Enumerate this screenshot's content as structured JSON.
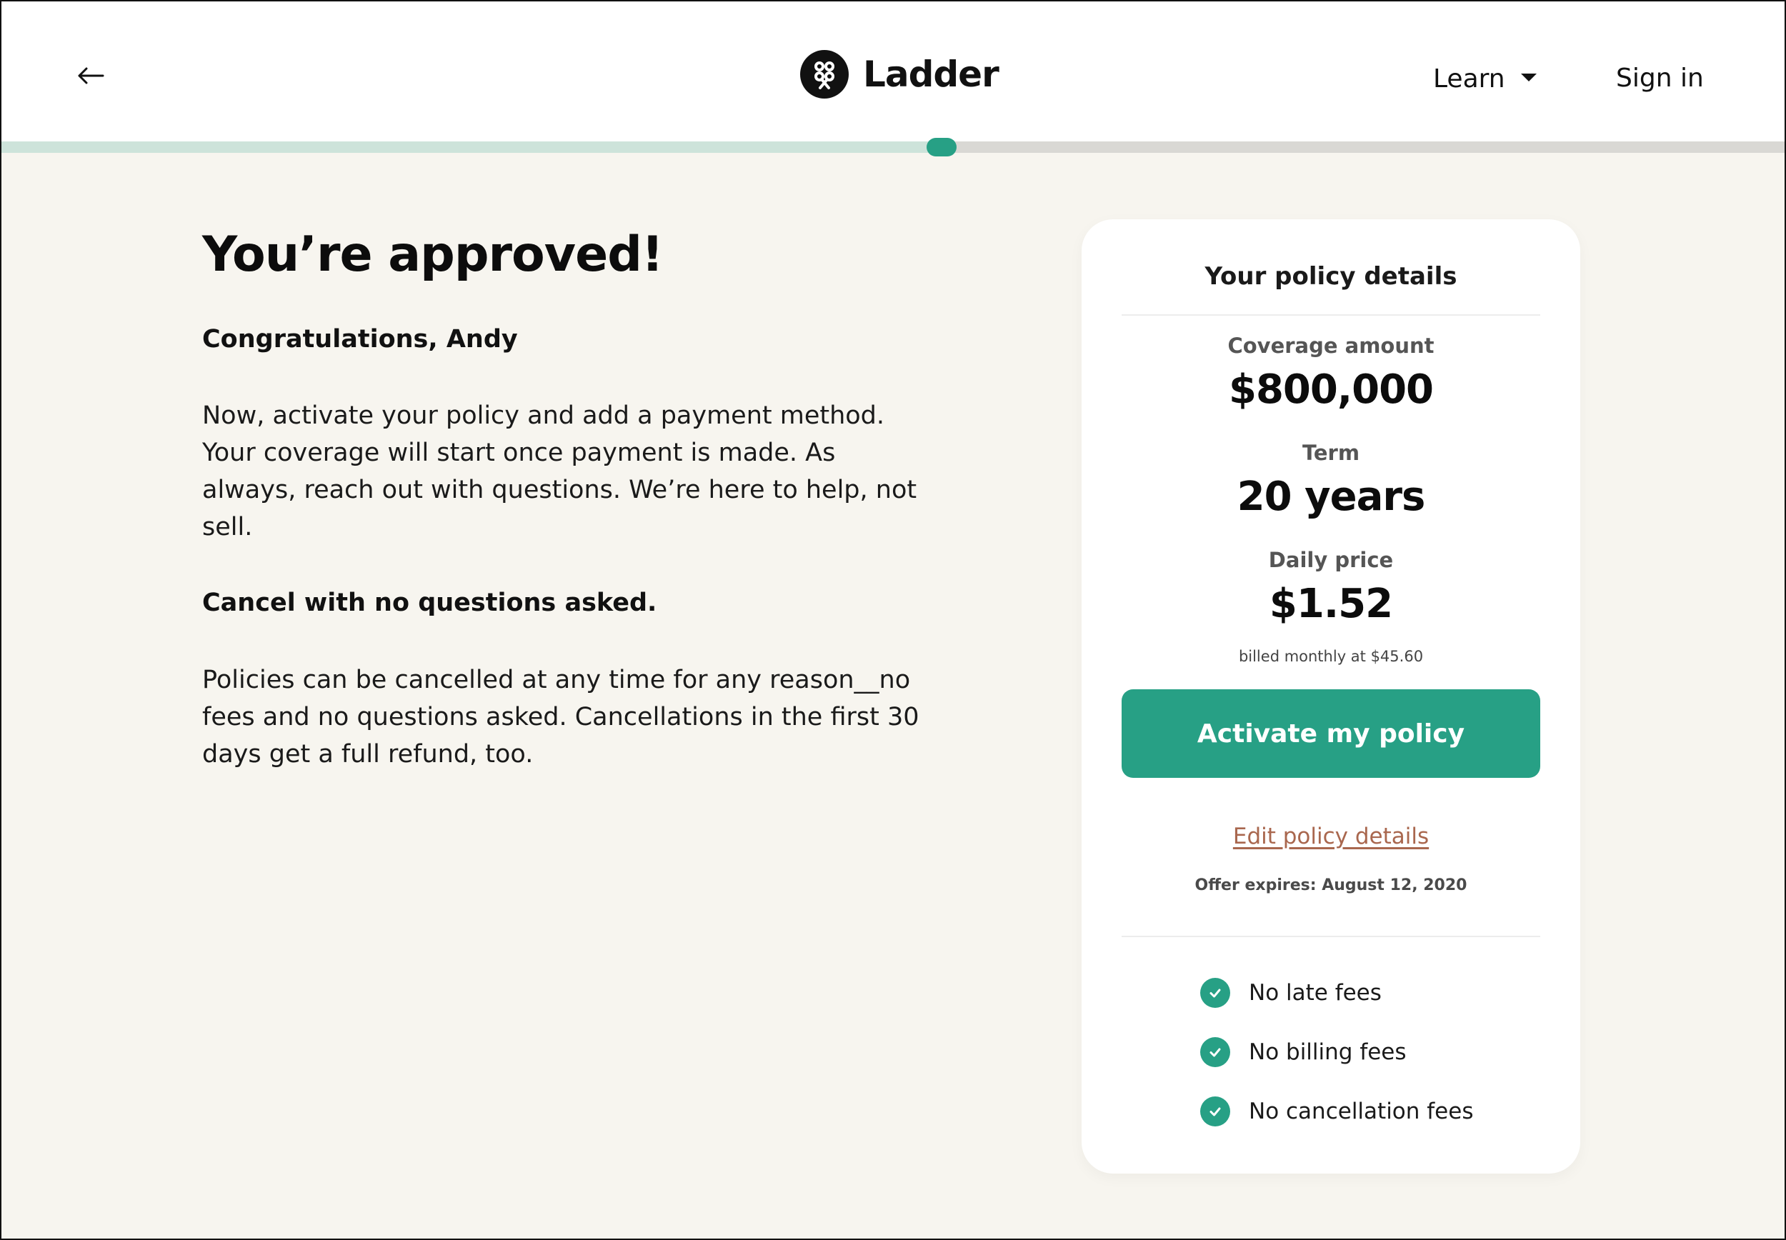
{
  "header": {
    "brand_name": "Ladder",
    "nav": {
      "learn_label": "Learn",
      "signin_label": "Sign in"
    }
  },
  "progress": {
    "fraction": 0.527,
    "fill_color": "#cde3da",
    "knob_color": "#27a085",
    "track_color": "#d9d8d4"
  },
  "content": {
    "headline": "You’re approved!",
    "greeting": "Congratulations, Andy",
    "intro": "Now, activate your policy and add a payment method. Your coverage will start once payment is made. As always, reach out with questions. We’re here to help, not sell.",
    "cancel_heading": "Cancel with no questions asked.",
    "cancel_text": "Policies can be cancelled at any time for any reason__no fees and no questions asked. Cancellations in the first 30 days get a full refund, too."
  },
  "policy": {
    "title": "Your policy details",
    "coverage_label": "Coverage amount",
    "coverage_value": "$800,000",
    "term_label": "Term",
    "term_value": "20 years",
    "daily_label": "Daily price",
    "daily_value": "$1.52",
    "billed_note": "billed monthly at $45.60",
    "activate_label": "Activate my policy",
    "edit_label": "Edit policy details",
    "offer_expires": "Offer expires: August 12, 2020",
    "features": [
      {
        "label": "No late fees",
        "icon": "check-circle-icon"
      },
      {
        "label": "No billing fees",
        "icon": "check-circle-icon"
      },
      {
        "label": "No cancellation fees",
        "icon": "check-circle-icon"
      }
    ]
  },
  "colors": {
    "accent": "#27a085",
    "link": "#a9674e",
    "page_background": "#f7f5ef"
  }
}
